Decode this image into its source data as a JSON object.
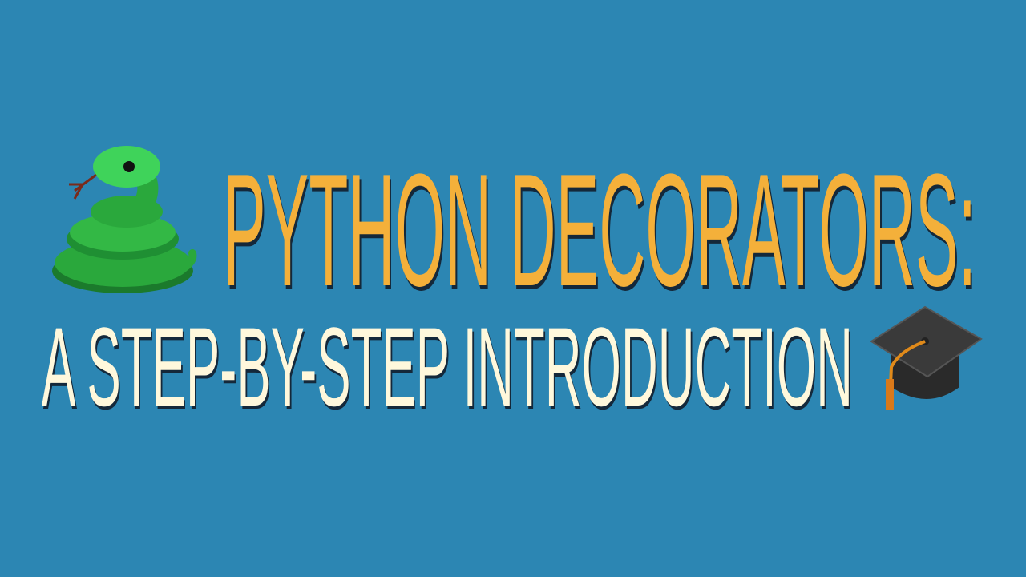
{
  "title": "Python Decorators:",
  "subtitle": "A Step-By-Step Introduction",
  "icons": {
    "left": "snake-emoji",
    "right": "graduation-cap-emoji"
  },
  "colors": {
    "background": "#2C86B3",
    "title": "#F4B03A",
    "subtitle": "#FFF8DC"
  }
}
